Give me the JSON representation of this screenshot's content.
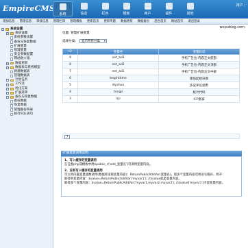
{
  "header": {
    "logo": "EmpireCMS",
    "logo_sub": "",
    "user_info": "用户 :",
    "nav": [
      {
        "label": "系统",
        "icon": "system-icon",
        "active": true
      },
      {
        "label": "信息",
        "icon": "info-icon",
        "active": false
      },
      {
        "label": "栏目",
        "icon": "column-icon",
        "active": false
      },
      {
        "label": "模板",
        "icon": "template-icon",
        "active": false
      },
      {
        "label": "用户",
        "icon": "user-icon",
        "active": false
      },
      {
        "label": "插件",
        "icon": "plugin-icon",
        "active": false
      },
      {
        "label": "其他",
        "icon": "other-icon",
        "active": false
      }
    ]
  },
  "subbar": {
    "items": [
      "增加信息",
      "管理信息",
      "审核信息",
      "管理栏目",
      "管理模板",
      "更新首页",
      "更新专题",
      "数据更新",
      "数据备份",
      "后台首页",
      "网站首页",
      "退出登录"
    ]
  },
  "watermark": "wopublog.com",
  "sidebar": {
    "items": [
      {
        "label": "系统设置",
        "level": 0,
        "kind": "root"
      },
      {
        "label": "系统设置",
        "level": 1,
        "kind": "folder"
      },
      {
        "label": "系统参数设置",
        "level": 2,
        "kind": "doc"
      },
      {
        "label": "备份与恢复数据",
        "level": 2,
        "kind": "doc"
      },
      {
        "label": "扩展变量",
        "level": 2,
        "kind": "doc"
      },
      {
        "label": "管理变量",
        "level": 2,
        "kind": "doc"
      },
      {
        "label": "安全参数配置",
        "level": 2,
        "kind": "doc"
      },
      {
        "label": "网站防火墙",
        "level": 2,
        "kind": "doc"
      },
      {
        "label": "数据更新",
        "level": 1,
        "kind": "folder"
      },
      {
        "label": "数据表与系统模型",
        "level": 1,
        "kind": "folder"
      },
      {
        "label": "新建数据表",
        "level": 2,
        "kind": "doc"
      },
      {
        "label": "管理数据表",
        "level": 2,
        "kind": "doc"
      },
      {
        "label": "计划任务",
        "level": 1,
        "kind": "folder"
      },
      {
        "label": "工作流",
        "level": 1,
        "kind": "folder"
      },
      {
        "label": "优化方案",
        "level": 1,
        "kind": "folder"
      },
      {
        "label": "扩展菜单",
        "level": 1,
        "kind": "folder"
      },
      {
        "label": "备份与恢复数据",
        "level": 1,
        "kind": "folder"
      },
      {
        "label": "备份数据",
        "level": 2,
        "kind": "doc"
      },
      {
        "label": "恢复数据",
        "level": 2,
        "kind": "doc"
      },
      {
        "label": "管理备份目录",
        "level": 2,
        "kind": "doc"
      },
      {
        "label": "执行SQL语句",
        "level": 2,
        "kind": "doc"
      }
    ]
  },
  "main": {
    "location": "位置: 管理扩展变量",
    "filter_label": "选择分类：",
    "filter_value": "显示所有分类",
    "columns": [
      "ID",
      "变量名",
      "变量标识"
    ],
    "rows": [
      [
        "9",
        "net_ad3",
        "手机广告位-内容正文底部"
      ],
      [
        "8",
        "net_ad2",
        "手机广告位-内容正文顶部"
      ],
      [
        "7",
        "net_ad1",
        "手机广告位-内容正文中部"
      ],
      [
        "6",
        "beginttime",
        "建站起始日期"
      ],
      [
        "5",
        "diyshuo",
        "多说评论调用"
      ],
      [
        "4",
        "tongji",
        "统计代码"
      ],
      [
        "3",
        "icp",
        "ICP备案"
      ]
    ],
    "page": "7"
  },
  "help": {
    "title": "扩展变量调用说明",
    "h1": "1、写入缓存的变量调用",
    "p1": "在任意php或模板中用$public_r['add_变量名']可调用变量内容。",
    "h2": "2、没有写入缓存的变量调用",
    "p2": "可以用内置变量函数调用(数据库读取变量内容)：ReturnPublicAddVar(变量名)。取多个变量内容可用逗号隔开，例子：",
    "p3": "取得单变量内容：$value=ReturnPublicAddVar('myvar1'); //$value就是变量内容。",
    "p4": "取得多个变量内容：$value=ReturnPublicAddVar('myvar1,myvar2,myvar3'); //$value['myvar1']才是变量内容。"
  }
}
